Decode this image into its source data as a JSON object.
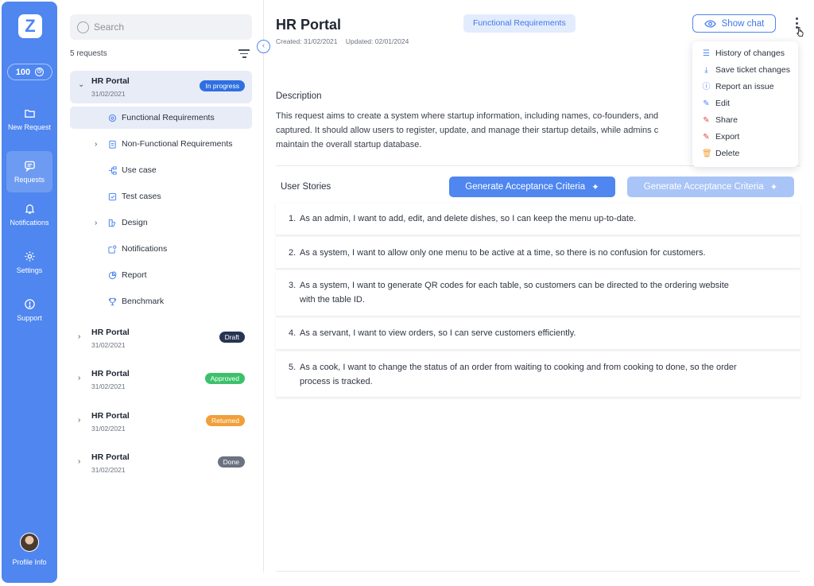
{
  "rail": {
    "logo": "Z",
    "credits": "100",
    "items": [
      {
        "label": "New Request",
        "icon": "folder-icon"
      },
      {
        "label": "Requests",
        "icon": "chat-icon"
      },
      {
        "label": "Notifications",
        "icon": "bell-icon"
      },
      {
        "label": "Settings",
        "icon": "gear-icon"
      },
      {
        "label": "Support",
        "icon": "support-icon"
      }
    ],
    "profile_label": "Profile Info"
  },
  "list": {
    "search_placeholder": "Search",
    "count": "5 requests",
    "requests": [
      {
        "title": "HR Portal",
        "date": "31/02/2021",
        "status": "In progress",
        "color": "#2f6fe0"
      },
      {
        "title": "HR Portal",
        "date": "31/02/2021",
        "status": "Draft",
        "color": "#273452"
      },
      {
        "title": "HR Portal",
        "date": "31/02/2021",
        "status": "Approved",
        "color": "#3cc16a"
      },
      {
        "title": "HR Portal",
        "date": "31/02/2021",
        "status": "Returned",
        "color": "#f0a03a"
      },
      {
        "title": "HR Portal",
        "date": "31/02/2021",
        "status": "Done",
        "color": "#6b7280"
      }
    ],
    "sections": [
      {
        "label": "Functional Requirements",
        "icon": "target-icon"
      },
      {
        "label": "Non-Functional Requirements",
        "icon": "clipboard-icon"
      },
      {
        "label": "Use case",
        "icon": "flow-icon"
      },
      {
        "label": "Test cases",
        "icon": "test-icon"
      },
      {
        "label": "Design",
        "icon": "design-icon"
      },
      {
        "label": "Notifications",
        "icon": "notification-icon"
      },
      {
        "label": "Report",
        "icon": "pie-icon"
      },
      {
        "label": "Benchmark",
        "icon": "trophy-icon"
      }
    ]
  },
  "main": {
    "title": "HR Portal",
    "created": "Created: 31/02/2021",
    "updated": "Updated: 02/01/2024",
    "tag": "Functional Requirements",
    "show_chat": "Show chat",
    "description_heading": "Description",
    "description_lines": [
      "This request aims to create a system where startup information, including names, co-founders, and",
      "captured. It should allow users to register, update, and manage their startup details, while admins c",
      "maintain the overall startup database."
    ],
    "user_stories_heading": "User Stories",
    "generate_label": "Generate Acceptance Criteria",
    "stories": [
      {
        "num": "1.",
        "text": "As an admin, I want to add, edit, and delete dishes, so I can keep the menu up-to-date."
      },
      {
        "num": "2.",
        "text": "As a system, I want to allow only one menu to be active at a time, so there is no confusion for customers."
      },
      {
        "num": "3.",
        "text": "As a system, I want to generate QR codes for each table, so customers can be directed to the ordering website with the table ID."
      },
      {
        "num": "4.",
        "text": "As a servant, I want to view orders, so I can serve customers efficiently."
      },
      {
        "num": "5.",
        "text": "As a cook, I want to change the status of an order from waiting to cooking and from cooking to done, so the order process is tracked."
      }
    ]
  },
  "menu": {
    "items": [
      {
        "label": "History of changes",
        "icon": "list-icon",
        "color": "#4f86ef"
      },
      {
        "label": "Save ticket changes",
        "icon": "save-icon",
        "color": "#4f86ef"
      },
      {
        "label": "Report an issue",
        "icon": "info-icon",
        "color": "#4f86ef"
      },
      {
        "label": "Edit",
        "icon": "pencil-icon",
        "color": "#4f86ef"
      },
      {
        "label": "Share",
        "icon": "share-icon",
        "color": "#e04848"
      },
      {
        "label": "Export",
        "icon": "export-icon",
        "color": "#e04848"
      },
      {
        "label": "Delete",
        "icon": "trash-icon",
        "color": "#f0a03a"
      }
    ]
  },
  "colors": {
    "accent": "#4f86ef",
    "accent_light": "#a9c4f6",
    "tag_bg": "#e3ecfd"
  }
}
